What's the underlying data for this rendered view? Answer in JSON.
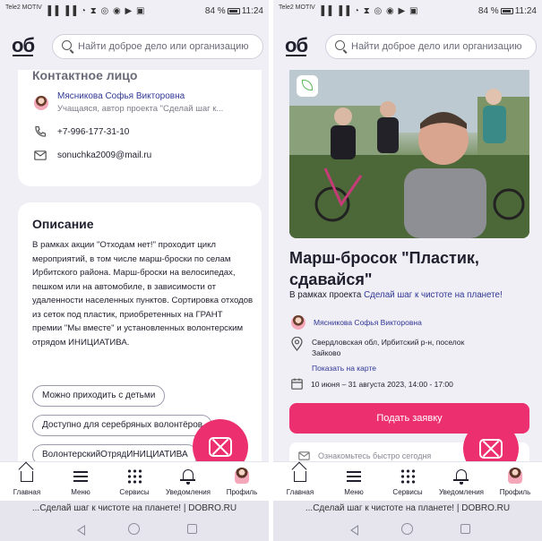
{
  "status_bar": {
    "carrier": "Tele2 MOTIV",
    "icons": "▐▐ ▐▐ ◔ ⧗ ◎ ◉ ▶ ▣",
    "battery": "84 %",
    "time": "11:24"
  },
  "header": {
    "logo": "об",
    "search_placeholder": "Найти доброе дело или организацию"
  },
  "left": {
    "contact": {
      "title": "Контактное лицо",
      "name": "Мясникова Софья Викторовна",
      "role": "Учащаяся, автор проекта \"Сделай шаг к...",
      "phone": "+7-996-177-31-10",
      "email": "sonuchka2009@mail.ru"
    },
    "description": {
      "title": "Описание",
      "text": "В рамках акции \"Отходам нет!\" проходит цикл мероприятий, в том числе марш-броски по селам Ирбитского района. Марш-броски на велосипедах, пешком или на автомобиле, в зависимости от удаленности населенных пунктов. Сортировка отходов из сеток под пластик, приобретенных на ГРАНТ премии \"Мы вместе\" и установленных волонтерским отрядом ИНИЦИАТИВА.",
      "tags": [
        "Можно приходить с детьми",
        "Доступно для серебряных волонтёров",
        "ВолонтерскийОтрядИНИЦИАТИВА"
      ]
    }
  },
  "right": {
    "event_title": "Марш-бросок \"Пластик, сдавайся\"",
    "project_prefix": "В рамках проекта",
    "project_link": "Сделай шаг к чистоте на планете!",
    "organizer": "Мясникова Софья Викторовна",
    "address": "Свердловская обл, Ирбитский р-н, поселок Зайково",
    "map_link": "Показать на карте",
    "dates": "10 июня – 31 августа 2023, 14:00 - 17:00",
    "apply_button": "Подать заявку",
    "partial_text": "Ознакомьтесь быстро сегодня"
  },
  "tabbar": {
    "items": [
      {
        "label": "Главная",
        "icon": "home-icon"
      },
      {
        "label": "Меню",
        "icon": "menu-icon"
      },
      {
        "label": "Сервисы",
        "icon": "grid-icon"
      },
      {
        "label": "Уведомления",
        "icon": "bell-icon"
      },
      {
        "label": "Профиль",
        "icon": "avatar-icon"
      }
    ]
  },
  "browser": {
    "url": "...Сделай шаг к чистоте на планете! | DOBRO.RU"
  },
  "colors": {
    "accent": "#ec2f6e",
    "link": "#303796",
    "background": "#f0eff5",
    "card": "#ffffff"
  }
}
